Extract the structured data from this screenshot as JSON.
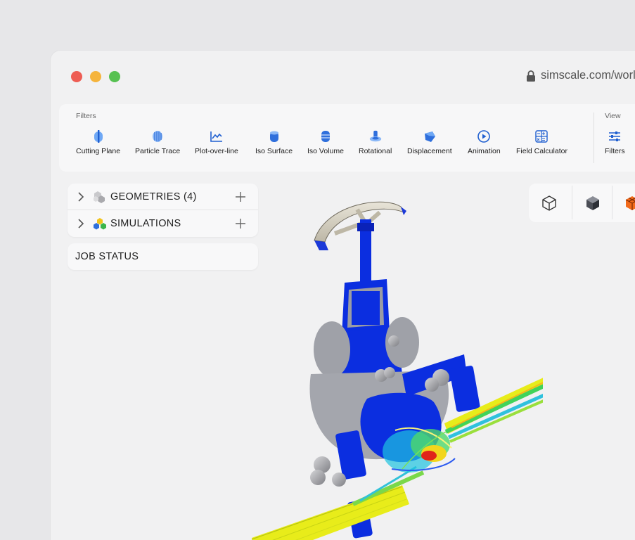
{
  "window": {
    "url": "simscale.com/worl"
  },
  "toolbar": {
    "filters_label": "Filters",
    "view_label": "View",
    "tools": [
      {
        "label": "Cutting Plane",
        "icon": "cutting-plane-icon"
      },
      {
        "label": "Particle Trace",
        "icon": "particle-trace-icon"
      },
      {
        "label": "Plot-over-line",
        "icon": "plot-over-line-icon"
      },
      {
        "label": "Iso Surface",
        "icon": "iso-surface-icon"
      },
      {
        "label": "Iso Volume",
        "icon": "iso-volume-icon"
      },
      {
        "label": "Rotational",
        "icon": "rotational-icon"
      },
      {
        "label": "Displacement",
        "icon": "displacement-icon"
      },
      {
        "label": "Animation",
        "icon": "animation-icon"
      },
      {
        "label": "Field Calculator",
        "icon": "field-calculator-icon"
      }
    ],
    "view_tools": [
      {
        "label": "Filters",
        "icon": "sliders-icon"
      }
    ]
  },
  "tree": {
    "geometries": "GEOMETRIES (4)",
    "simulations": "SIMULATIONS",
    "job_status": "JOB STATUS"
  },
  "colors": {
    "accent": "#2f6fdc",
    "mesh_blue": "#0b2ee0",
    "flow_yellow": "#e8ec1a",
    "flow_red": "#e0241a"
  }
}
